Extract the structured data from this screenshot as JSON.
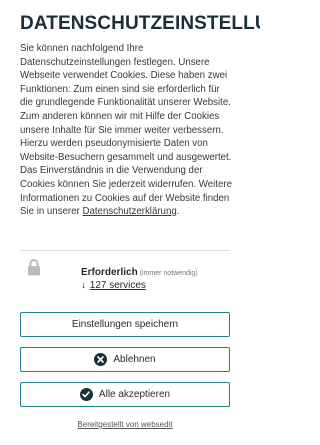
{
  "dialog": {
    "title": "DATENSCHUTZEINSTELLUN",
    "description": "Sie können nachfolgend Ihre Datenschutzeinstellungen festlegen. Unsere Webseite verwendet Cookies. Diese haben zwei Funktionen: Zum einen sind sie erforderlich für die grundlegende Funktionalität unserer Website. Zum anderen können wir mit Hilfe der Cookies unsere Inhalte für Sie immer weiter verbessern. Hierzu werden pseudonymisierte Daten von Website-Besuchern gesammelt und ausgewertet. Das Einverständnis in die Verwendung der Cookies können Sie jederzeit widerrufen. Weitere Informationen zu Cookies auf der Website finden Sie in unserer",
    "privacy_link": "Datenschutzerklärung",
    "description_end": "."
  },
  "category": {
    "name": "Erforderlich",
    "note": "(immer notwendig)",
    "services_arrow": "↓",
    "services_label": "127 services"
  },
  "buttons": {
    "save": "Einstellungen speichern",
    "reject": "Ablehnen",
    "accept": "Alle akzeptieren"
  },
  "footer": {
    "credit": "Bereitgestellt von websedit"
  },
  "colors": {
    "accent": "#1d7f8d",
    "title": "#1b2f3a"
  },
  "icons": {
    "lock": "lock-icon",
    "reject": "close-icon",
    "accept": "check-icon"
  }
}
